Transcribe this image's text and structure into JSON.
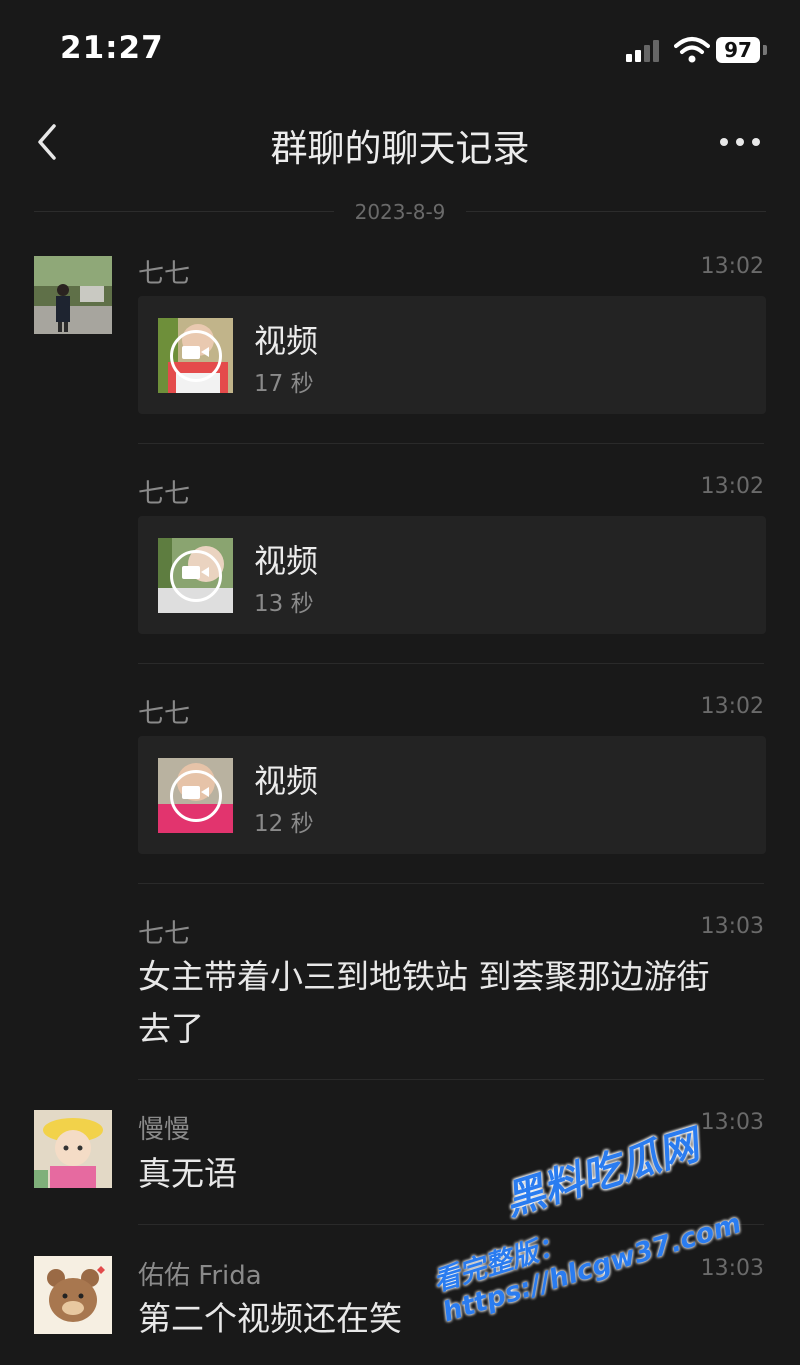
{
  "status_bar": {
    "time": "21:27",
    "battery": "97"
  },
  "nav": {
    "title": "群聊的聊天记录",
    "back_icon": "chevron-left-icon",
    "more_icon": "ellipsis-icon"
  },
  "date_divider": "2023-8-9",
  "messages": [
    {
      "sender": "七七",
      "time": "13:02",
      "type": "video",
      "label": "视频",
      "duration": "17 秒"
    },
    {
      "sender": "七七",
      "time": "13:02",
      "type": "video",
      "label": "视频",
      "duration": "13 秒"
    },
    {
      "sender": "七七",
      "time": "13:02",
      "type": "video",
      "label": "视频",
      "duration": "12 秒"
    },
    {
      "sender": "七七",
      "time": "13:03",
      "type": "text",
      "text": "女主带着小三到地铁站 到荟聚那边游街去了"
    },
    {
      "sender": "慢慢",
      "time": "13:03",
      "type": "text",
      "text": "真无语"
    },
    {
      "sender": "佑佑 Frida",
      "time": "13:03",
      "type": "text",
      "text": "第二个视频还在笑"
    }
  ],
  "watermark": {
    "brand": "黑料吃瓜网",
    "url": "看完整版：https://hlcgw37.com"
  }
}
